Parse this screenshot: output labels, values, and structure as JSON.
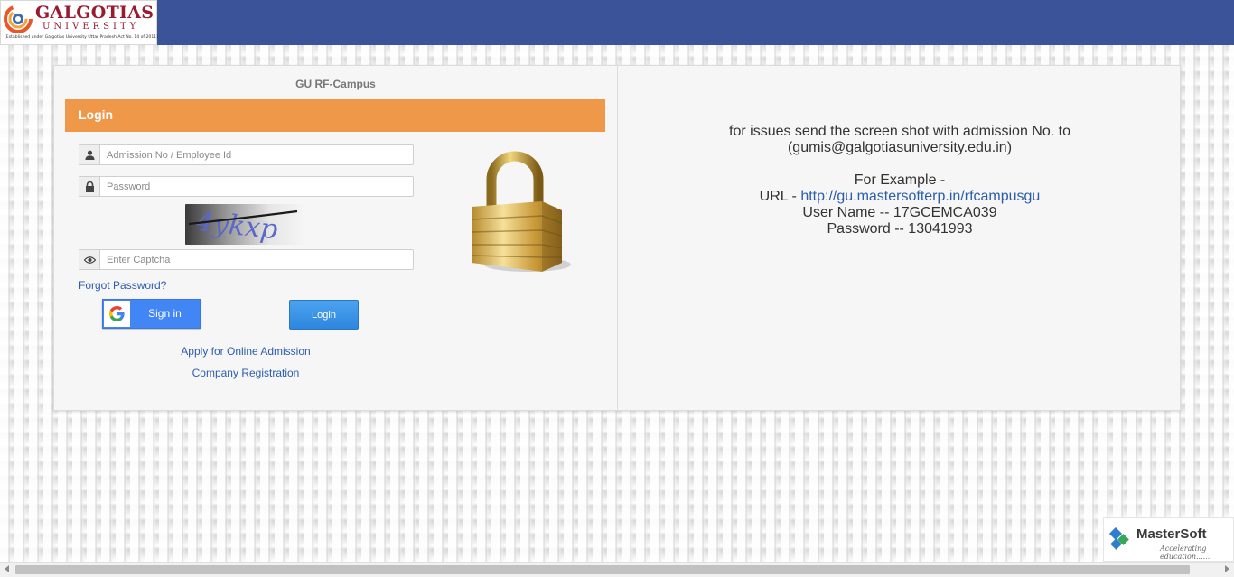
{
  "header": {
    "logo": {
      "name": "GALGOTIAS",
      "subtitle": "UNIVERSITY",
      "tagline": "(Established under Galgotias University Uttar Pradesh Act No. 14 of 2011)"
    }
  },
  "login_panel": {
    "title": "GU RF-Campus",
    "section_label": "Login",
    "fields": {
      "admission": {
        "placeholder": "Admission No / Employee Id",
        "value": ""
      },
      "password": {
        "placeholder": "Password",
        "value": ""
      },
      "captcha": {
        "placeholder": "Enter Captcha",
        "value": ""
      }
    },
    "captcha_text": "4ykxp",
    "forgot_password": "Forgot Password?",
    "google_signin": "Sign in",
    "login_button": "Login",
    "links": {
      "online_admission": "Apply for Online Admission",
      "company_registration": "Company Registration"
    }
  },
  "info_panel": {
    "line1": "for issues send the screen shot with admission No. to",
    "line2": "(gumis@galgotiasuniversity.edu.in)",
    "example_heading": "For Example -",
    "url_label": "URL - ",
    "url_link": "http://gu.mastersofterp.in/rfcampusgu",
    "username": "User Name -- 17GCEMCA039",
    "password": "Password -- 13041993"
  },
  "footer": {
    "brand": "MasterSoft",
    "tagline": "Accelerating education......"
  },
  "icons": {
    "user": "user-icon",
    "lock": "lock-icon",
    "eye": "eye-icon",
    "google": "google-g-icon",
    "padlock": "padlock-icon"
  },
  "colors": {
    "header": "#3a5399",
    "login_bar": "#f0984a",
    "link": "#2a5dad",
    "google_blue": "#4285f4",
    "login_button": "#3a93e6"
  }
}
